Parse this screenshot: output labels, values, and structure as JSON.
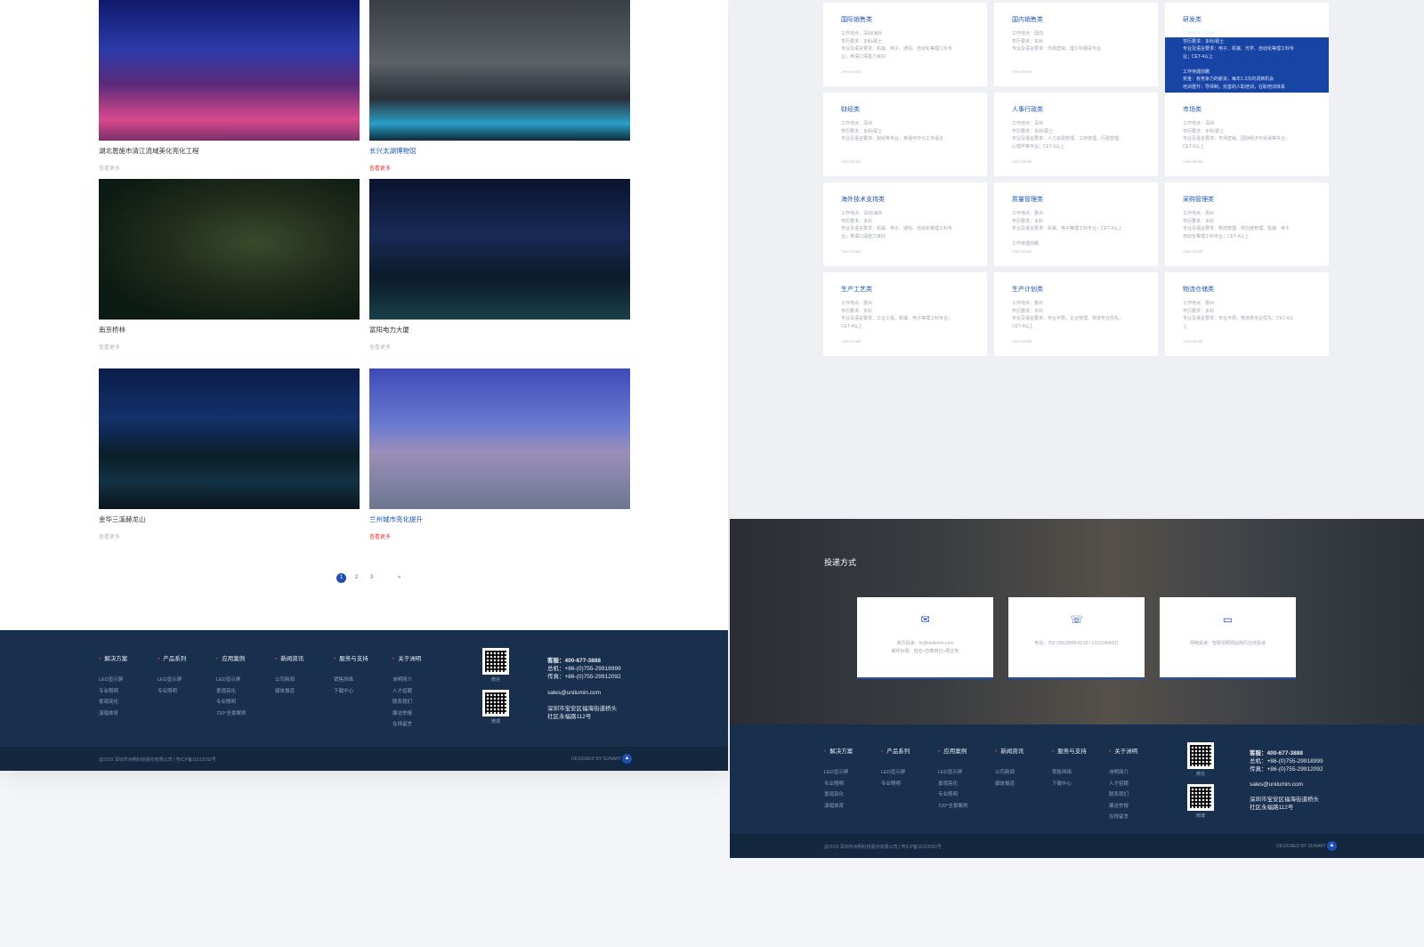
{
  "cases": [
    {
      "title": "湖北恩施市清江流域美化亮化工程",
      "more": "查看更多",
      "highlight": false
    },
    {
      "title": "长兴太湖博物馆",
      "more": "查看更多",
      "highlight": true
    },
    {
      "title": "南京桥林",
      "more": "查看更多",
      "highlight": false
    },
    {
      "title": "富阳电力大厦",
      "more": "查看更多",
      "highlight": false
    },
    {
      "title": "金华三溪赫龙山",
      "more": "查看更多",
      "highlight": false
    },
    {
      "title": "兰州城市亮化提升",
      "more": "查看更多",
      "highlight": true
    }
  ],
  "pagination": {
    "pages": [
      "1",
      "2",
      "3"
    ],
    "next": "»"
  },
  "footer": {
    "columns": [
      {
        "heading": "解决方案",
        "items": [
          "LED显示屏",
          "专业照明",
          "景观亮化",
          "演唱体育"
        ]
      },
      {
        "heading": "产品系列",
        "items": [
          "LED显示屏",
          "专业照明"
        ]
      },
      {
        "heading": "应用案例",
        "items": [
          "LED显示屏",
          "景观亮化",
          "专业照明",
          "720°全景案例"
        ]
      },
      {
        "heading": "新闻资讯",
        "items": [
          "公司新闻",
          "媒体报道"
        ]
      },
      {
        "heading": "服务与支持",
        "items": [
          "销售网络",
          "下载中心"
        ]
      },
      {
        "heading": "关于洲明",
        "items": [
          "洲明简介",
          "人才招聘",
          "联系我们",
          "廉洁举报",
          "在线留言"
        ]
      }
    ],
    "qr_captions": [
      "微信",
      "微博"
    ],
    "hotline": "客服：400-677-3888",
    "tel": "总机：+86-(0)755-29918999",
    "fax": "传真：+86-(0)755-29912092",
    "email": "sales@unilumin.com",
    "address_1": "深圳市宝安区福海街道桥头",
    "address_2": "社区永福路112号",
    "copyright": "@2019 深圳市洲明科技股份有限公司 | 粤ICP备11012092号",
    "designed": "DESIGNED BY SUNART",
    "back_to_top": "▲"
  },
  "jobs": [
    {
      "title": "国际销售类",
      "lines": [
        "工作地点：深圳/海外",
        "学历要求：本科/硕士",
        "专业及语言要求：机械、电子、通信、自动化等理工科专",
        "业；英语口语能力良好"
      ],
      "view": "View Detail",
      "active": false
    },
    {
      "title": "国内销售类",
      "lines": [
        "工作地点：国内",
        "学历要求：本科",
        "专业及语言要求：市场营销、理工科相关专业"
      ],
      "view": "View Detail",
      "active": false
    },
    {
      "title": "研发类",
      "lines": [
        "工作地点：深圳",
        "学历要求：本科/硕士",
        "专业及语言要求：电子、机械、光学、自动化等理工科专",
        "业；CET-4以上",
        "",
        "工作待遇前瞻",
        "奖金：有竞争力的薪资，每年1-2次的调薪机会",
        "培训晋升：导师制，完善的人职培训，在职培训体系"
      ],
      "count": "招聘人数：60",
      "view": "",
      "active": true
    },
    {
      "title": "财经类",
      "lines": [
        "工作地点：深圳",
        "学历要求：本科/硕士",
        "专业及语言要求：财经类专业，英语可作为工作语言"
      ],
      "view": "View Detail",
      "active": false
    },
    {
      "title": "人事行政类",
      "lines": [
        "工作地点：深圳",
        "学历要求：本科/硕士",
        "专业及语言要求：人力资源管理、工商管理、行政管理、",
        "心理学等专业；CET-6以上"
      ],
      "view": "View Detail",
      "active": false
    },
    {
      "title": "市场类",
      "lines": [
        "工作地点：深圳",
        "学历要求：本科/硕士",
        "专业及语言要求：市场营销、国际经济与贸易等专业；",
        "CET-6以上"
      ],
      "view": "View Detail",
      "active": false
    },
    {
      "title": "海外技术支持类",
      "lines": [
        "工作地点：深圳/海外",
        "学历要求：本科",
        "专业及语言要求：机械、电子、通信、自动化等理工科专",
        "业；英语口语能力良好"
      ],
      "view": "View Detail",
      "active": false
    },
    {
      "title": "质量管理类",
      "lines": [
        "工作地点：惠州",
        "学历要求：本科",
        "专业及语言要求：机械、电子等理工科专业；CET-4以上",
        "",
        "工作待遇前瞻"
      ],
      "view": "View Detail",
      "active": false
    },
    {
      "title": "采购管理类",
      "lines": [
        "工作地点：惠州",
        "学历要求：本科",
        "专业及语言要求：物流管理、供应链管理、机械、电子",
        "自动化等理工科专业；CET-4以上"
      ],
      "view": "View Detail",
      "active": false
    },
    {
      "title": "生产工艺类",
      "lines": [
        "工作地点：惠州",
        "学历要求：本科",
        "专业及语言要求：工业工程、机械、电子等理工科专业；",
        "CET-4以上"
      ],
      "view": "View Detail",
      "active": false
    },
    {
      "title": "生产计划类",
      "lines": [
        "工作地点：惠州",
        "学历要求：本科",
        "专业及语言要求：专业不限，企业管理、物流专业优先；",
        "CET-4以上"
      ],
      "view": "View Detail",
      "active": false
    },
    {
      "title": "物流仓储类",
      "lines": [
        "工作地点：惠州",
        "学历要求：本科",
        "专业及语言要求：专业不限，物流类专业优先；CET-4以",
        "上"
      ],
      "view": "View Detail",
      "active": false
    }
  ],
  "contact_section": {
    "title": "投递方式",
    "cards": [
      {
        "icon": "envelope-icon",
        "glyph": "✉",
        "lines": [
          "简历投递：hr@unilumin.com",
          "邮件标题：姓名+应聘岗位+居住地"
        ]
      },
      {
        "icon": "phone-icon",
        "glyph": "☏",
        "lines": [
          "电话：755-29918999-8218 / 13312456001"
        ]
      },
      {
        "icon": "monitor-icon",
        "glyph": "▭",
        "lines": [
          "网络投递：智联招聘网站简历在线投递"
        ]
      }
    ]
  },
  "colors": {
    "accent": "#1f4fb4",
    "footer": "#182f4d",
    "highlight_red": "#e53b36"
  }
}
